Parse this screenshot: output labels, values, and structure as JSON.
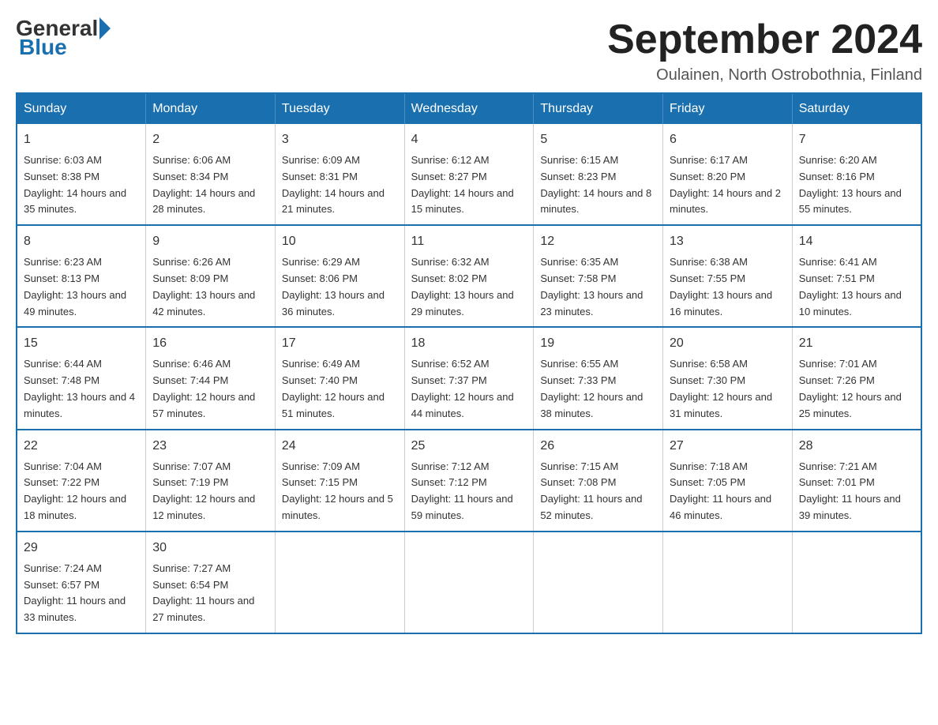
{
  "logo": {
    "general": "General",
    "blue": "Blue"
  },
  "title": "September 2024",
  "location": "Oulainen, North Ostrobothnia, Finland",
  "weekdays": [
    "Sunday",
    "Monday",
    "Tuesday",
    "Wednesday",
    "Thursday",
    "Friday",
    "Saturday"
  ],
  "weeks": [
    [
      {
        "day": "1",
        "sunrise": "6:03 AM",
        "sunset": "8:38 PM",
        "daylight": "14 hours and 35 minutes."
      },
      {
        "day": "2",
        "sunrise": "6:06 AM",
        "sunset": "8:34 PM",
        "daylight": "14 hours and 28 minutes."
      },
      {
        "day": "3",
        "sunrise": "6:09 AM",
        "sunset": "8:31 PM",
        "daylight": "14 hours and 21 minutes."
      },
      {
        "day": "4",
        "sunrise": "6:12 AM",
        "sunset": "8:27 PM",
        "daylight": "14 hours and 15 minutes."
      },
      {
        "day": "5",
        "sunrise": "6:15 AM",
        "sunset": "8:23 PM",
        "daylight": "14 hours and 8 minutes."
      },
      {
        "day": "6",
        "sunrise": "6:17 AM",
        "sunset": "8:20 PM",
        "daylight": "14 hours and 2 minutes."
      },
      {
        "day": "7",
        "sunrise": "6:20 AM",
        "sunset": "8:16 PM",
        "daylight": "13 hours and 55 minutes."
      }
    ],
    [
      {
        "day": "8",
        "sunrise": "6:23 AM",
        "sunset": "8:13 PM",
        "daylight": "13 hours and 49 minutes."
      },
      {
        "day": "9",
        "sunrise": "6:26 AM",
        "sunset": "8:09 PM",
        "daylight": "13 hours and 42 minutes."
      },
      {
        "day": "10",
        "sunrise": "6:29 AM",
        "sunset": "8:06 PM",
        "daylight": "13 hours and 36 minutes."
      },
      {
        "day": "11",
        "sunrise": "6:32 AM",
        "sunset": "8:02 PM",
        "daylight": "13 hours and 29 minutes."
      },
      {
        "day": "12",
        "sunrise": "6:35 AM",
        "sunset": "7:58 PM",
        "daylight": "13 hours and 23 minutes."
      },
      {
        "day": "13",
        "sunrise": "6:38 AM",
        "sunset": "7:55 PM",
        "daylight": "13 hours and 16 minutes."
      },
      {
        "day": "14",
        "sunrise": "6:41 AM",
        "sunset": "7:51 PM",
        "daylight": "13 hours and 10 minutes."
      }
    ],
    [
      {
        "day": "15",
        "sunrise": "6:44 AM",
        "sunset": "7:48 PM",
        "daylight": "13 hours and 4 minutes."
      },
      {
        "day": "16",
        "sunrise": "6:46 AM",
        "sunset": "7:44 PM",
        "daylight": "12 hours and 57 minutes."
      },
      {
        "day": "17",
        "sunrise": "6:49 AM",
        "sunset": "7:40 PM",
        "daylight": "12 hours and 51 minutes."
      },
      {
        "day": "18",
        "sunrise": "6:52 AM",
        "sunset": "7:37 PM",
        "daylight": "12 hours and 44 minutes."
      },
      {
        "day": "19",
        "sunrise": "6:55 AM",
        "sunset": "7:33 PM",
        "daylight": "12 hours and 38 minutes."
      },
      {
        "day": "20",
        "sunrise": "6:58 AM",
        "sunset": "7:30 PM",
        "daylight": "12 hours and 31 minutes."
      },
      {
        "day": "21",
        "sunrise": "7:01 AM",
        "sunset": "7:26 PM",
        "daylight": "12 hours and 25 minutes."
      }
    ],
    [
      {
        "day": "22",
        "sunrise": "7:04 AM",
        "sunset": "7:22 PM",
        "daylight": "12 hours and 18 minutes."
      },
      {
        "day": "23",
        "sunrise": "7:07 AM",
        "sunset": "7:19 PM",
        "daylight": "12 hours and 12 minutes."
      },
      {
        "day": "24",
        "sunrise": "7:09 AM",
        "sunset": "7:15 PM",
        "daylight": "12 hours and 5 minutes."
      },
      {
        "day": "25",
        "sunrise": "7:12 AM",
        "sunset": "7:12 PM",
        "daylight": "11 hours and 59 minutes."
      },
      {
        "day": "26",
        "sunrise": "7:15 AM",
        "sunset": "7:08 PM",
        "daylight": "11 hours and 52 minutes."
      },
      {
        "day": "27",
        "sunrise": "7:18 AM",
        "sunset": "7:05 PM",
        "daylight": "11 hours and 46 minutes."
      },
      {
        "day": "28",
        "sunrise": "7:21 AM",
        "sunset": "7:01 PM",
        "daylight": "11 hours and 39 minutes."
      }
    ],
    [
      {
        "day": "29",
        "sunrise": "7:24 AM",
        "sunset": "6:57 PM",
        "daylight": "11 hours and 33 minutes."
      },
      {
        "day": "30",
        "sunrise": "7:27 AM",
        "sunset": "6:54 PM",
        "daylight": "11 hours and 27 minutes."
      },
      null,
      null,
      null,
      null,
      null
    ]
  ],
  "labels": {
    "sunrise": "Sunrise:",
    "sunset": "Sunset:",
    "daylight": "Daylight:"
  }
}
